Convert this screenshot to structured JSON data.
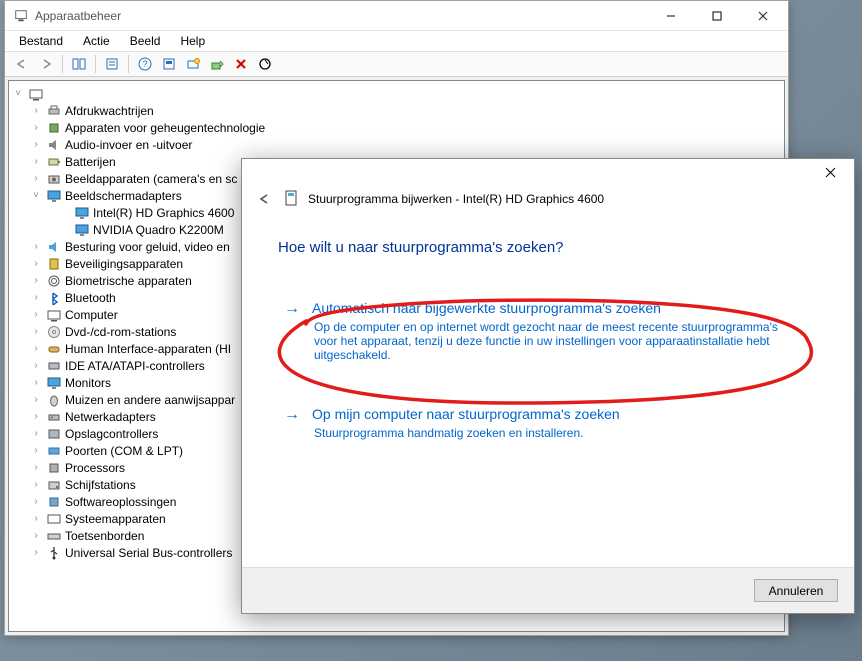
{
  "devmgr": {
    "title": "Apparaatbeheer",
    "menus": [
      "Bestand",
      "Actie",
      "Beeld",
      "Help"
    ],
    "root": "",
    "nodes": [
      {
        "icon": "printer",
        "label": "Afdrukwachtrijen",
        "expandable": true
      },
      {
        "icon": "chip",
        "label": "Apparaten voor geheugentechnologie",
        "expandable": true
      },
      {
        "icon": "speaker",
        "label": "Audio-invoer en -uitvoer",
        "expandable": true
      },
      {
        "icon": "battery",
        "label": "Batterijen",
        "expandable": true
      },
      {
        "icon": "camera",
        "label": "Beeldapparaten (camera's en sc",
        "expandable": true
      },
      {
        "icon": "display",
        "label": "Beeldschermadapters",
        "expandable": true,
        "expanded": true,
        "children": [
          {
            "icon": "display",
            "label": "Intel(R) HD Graphics 4600"
          },
          {
            "icon": "display",
            "label": "NVIDIA Quadro K2200M"
          }
        ]
      },
      {
        "icon": "audio",
        "label": "Besturing voor geluid, video en",
        "expandable": true
      },
      {
        "icon": "security",
        "label": "Beveiligingsapparaten",
        "expandable": true
      },
      {
        "icon": "biometric",
        "label": "Biometrische apparaten",
        "expandable": true
      },
      {
        "icon": "bluetooth",
        "label": "Bluetooth",
        "expandable": true
      },
      {
        "icon": "computer",
        "label": "Computer",
        "expandable": true
      },
      {
        "icon": "disc",
        "label": "Dvd-/cd-rom-stations",
        "expandable": true
      },
      {
        "icon": "hid",
        "label": "Human Interface-apparaten (HI",
        "expandable": true
      },
      {
        "icon": "ide",
        "label": "IDE ATA/ATAPI-controllers",
        "expandable": true
      },
      {
        "icon": "monitor",
        "label": "Monitors",
        "expandable": true
      },
      {
        "icon": "mouse",
        "label": "Muizen en andere aanwijsappar",
        "expandable": true
      },
      {
        "icon": "network",
        "label": "Netwerkadapters",
        "expandable": true
      },
      {
        "icon": "storage",
        "label": "Opslagcontrollers",
        "expandable": true
      },
      {
        "icon": "port",
        "label": "Poorten (COM & LPT)",
        "expandable": true
      },
      {
        "icon": "cpu",
        "label": "Processors",
        "expandable": true
      },
      {
        "icon": "disk",
        "label": "Schijfstations",
        "expandable": true
      },
      {
        "icon": "software",
        "label": "Softwareoplossingen",
        "expandable": true
      },
      {
        "icon": "system",
        "label": "Systeemapparaten",
        "expandable": true
      },
      {
        "icon": "keyboard",
        "label": "Toetsenborden",
        "expandable": true
      },
      {
        "icon": "usb",
        "label": "Universal Serial Bus-controllers",
        "expandable": true
      }
    ]
  },
  "dialog": {
    "title": "Stuurprogramma bijwerken - Intel(R) HD Graphics 4600",
    "question": "Hoe wilt u naar stuurprogramma's zoeken?",
    "option1": {
      "title": "Automatisch naar bijgewerkte stuurprogramma's zoeken",
      "desc": "Op de computer en op internet wordt gezocht naar de meest recente stuurprogramma's voor het apparaat, tenzij u deze functie in uw instellingen voor apparaatinstallatie hebt uitgeschakeld."
    },
    "option2": {
      "title": "Op mijn computer naar stuurprogramma's zoeken",
      "desc": "Stuurprogramma handmatig zoeken en installeren."
    },
    "cancel": "Annuleren"
  }
}
